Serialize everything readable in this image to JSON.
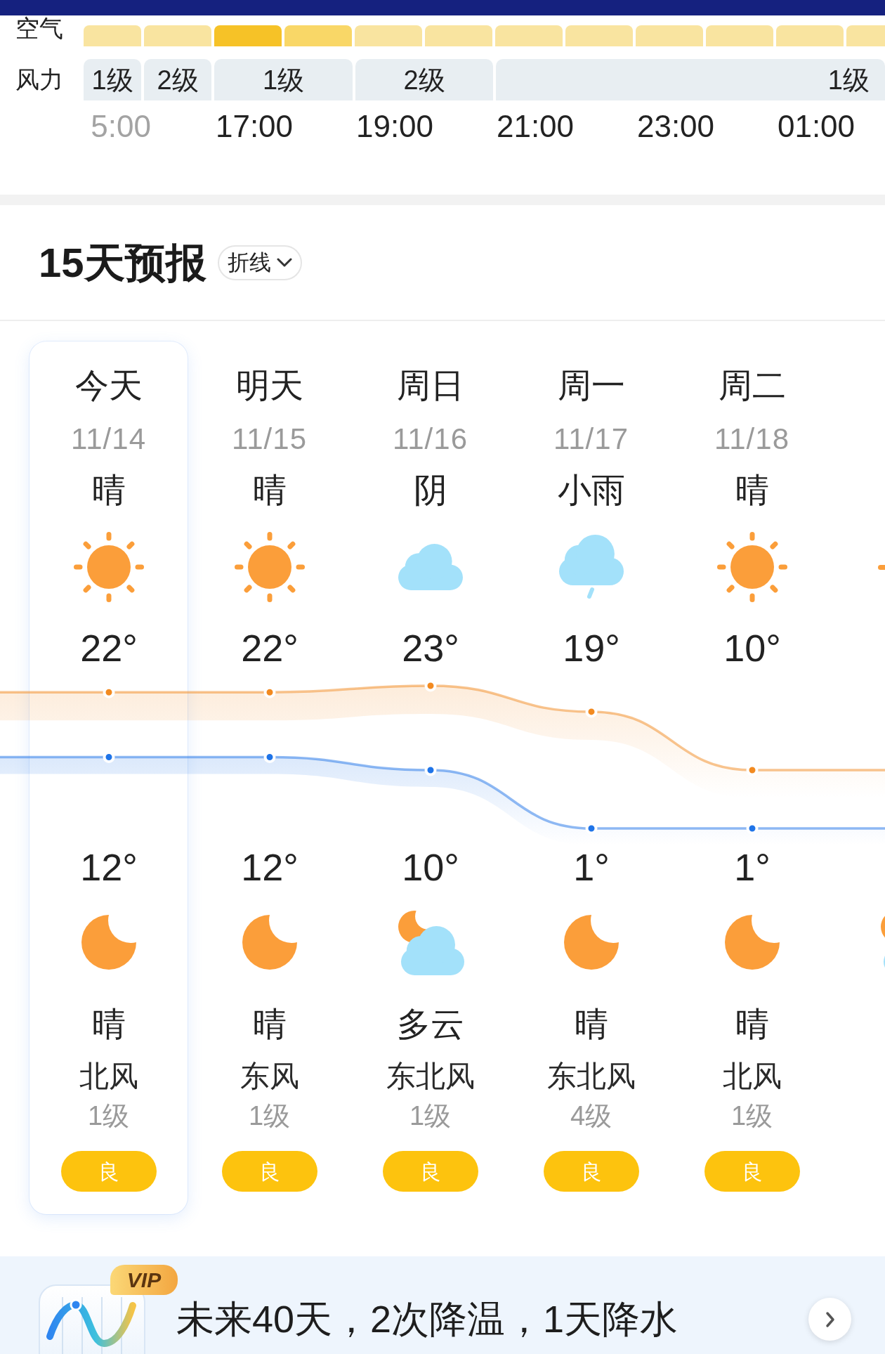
{
  "hourly": {
    "air_label": "空气",
    "air": [
      {
        "color": "#f9e4a0"
      },
      {
        "color": "#f9e4a0"
      },
      {
        "color": "#f6c227"
      },
      {
        "color": "#f9d767"
      },
      {
        "color": "#f9e4a0"
      },
      {
        "color": "#f9e4a0"
      },
      {
        "color": "#f9e4a0"
      },
      {
        "color": "#f9e4a0"
      },
      {
        "color": "#f9e4a0"
      },
      {
        "color": "#f9e4a0"
      },
      {
        "color": "#f9e4a0"
      },
      {
        "color": "#f9e4a0"
      }
    ],
    "wind_label": "风力",
    "wind": [
      {
        "text": "1级"
      },
      {
        "text": "2级"
      },
      {
        "text": "1级"
      },
      {
        "text": "2级"
      },
      {
        "text": "1级"
      }
    ],
    "times": [
      {
        "text": "5:00",
        "past": true
      },
      {
        "text": "17:00",
        "past": false
      },
      {
        "text": "19:00",
        "past": false
      },
      {
        "text": "21:00",
        "past": false
      },
      {
        "text": "23:00",
        "past": false
      },
      {
        "text": "01:00",
        "past": false
      }
    ]
  },
  "forecast": {
    "title": "15天预报",
    "view_toggle": "折线",
    "days": [
      {
        "weekday": "今天",
        "date": "11/14",
        "selected": true,
        "day": {
          "text": "晴",
          "kind": "sunny"
        },
        "night": {
          "kind": "clear_night",
          "text": "晴"
        },
        "wind": {
          "direction": "北风",
          "force": "1级"
        },
        "aqi": {
          "text": "良",
          "color": "#fdc30e"
        }
      },
      {
        "weekday": "明天",
        "date": "11/15",
        "selected": false,
        "day": {
          "text": "晴",
          "kind": "sunny"
        },
        "night": {
          "kind": "clear_night",
          "text": "晴"
        },
        "wind": {
          "direction": "东风",
          "force": "1级"
        },
        "aqi": {
          "text": "良",
          "color": "#fdc30e"
        }
      },
      {
        "weekday": "周日",
        "date": "11/16",
        "selected": false,
        "day": {
          "text": "阴",
          "kind": "cloudy"
        },
        "night": {
          "kind": "partly_cloudy_night",
          "text": "多云"
        },
        "wind": {
          "direction": "东北风",
          "force": "1级"
        },
        "aqi": {
          "text": "良",
          "color": "#fdc30e"
        }
      },
      {
        "weekday": "周一",
        "date": "11/17",
        "selected": false,
        "day": {
          "text": "小雨",
          "kind": "light_rain"
        },
        "night": {
          "kind": "clear_night",
          "text": "晴"
        },
        "wind": {
          "direction": "东北风",
          "force": "4级"
        },
        "aqi": {
          "text": "良",
          "color": "#fdc30e"
        }
      },
      {
        "weekday": "周二",
        "date": "11/18",
        "selected": false,
        "day": {
          "text": "晴",
          "kind": "sunny"
        },
        "night": {
          "kind": "clear_night",
          "text": "晴"
        },
        "wind": {
          "direction": "北风",
          "force": "1级"
        },
        "aqi": {
          "text": "良",
          "color": "#fdc30e"
        }
      },
      {
        "day": {
          "kind": "sunny"
        },
        "night": {
          "kind": "partly_cloudy_night"
        }
      }
    ],
    "chart_data": {
      "type": "line",
      "series": [
        {
          "color": "#f28a20",
          "marker": "circle",
          "values": [
            22,
            22,
            23,
            19,
            10
          ],
          "value_labels": [
            "22°",
            "22°",
            "23°",
            "19°",
            "10°"
          ]
        },
        {
          "color": "#1f74e8",
          "marker": "circle",
          "values": [
            12,
            12,
            10,
            1,
            1
          ],
          "value_labels": [
            "12°",
            "12°",
            "10°",
            "1°",
            "1°"
          ]
        }
      ]
    }
  },
  "promo": {
    "badge": "VIP",
    "text": "未来40天，2次降温，1天降水"
  }
}
